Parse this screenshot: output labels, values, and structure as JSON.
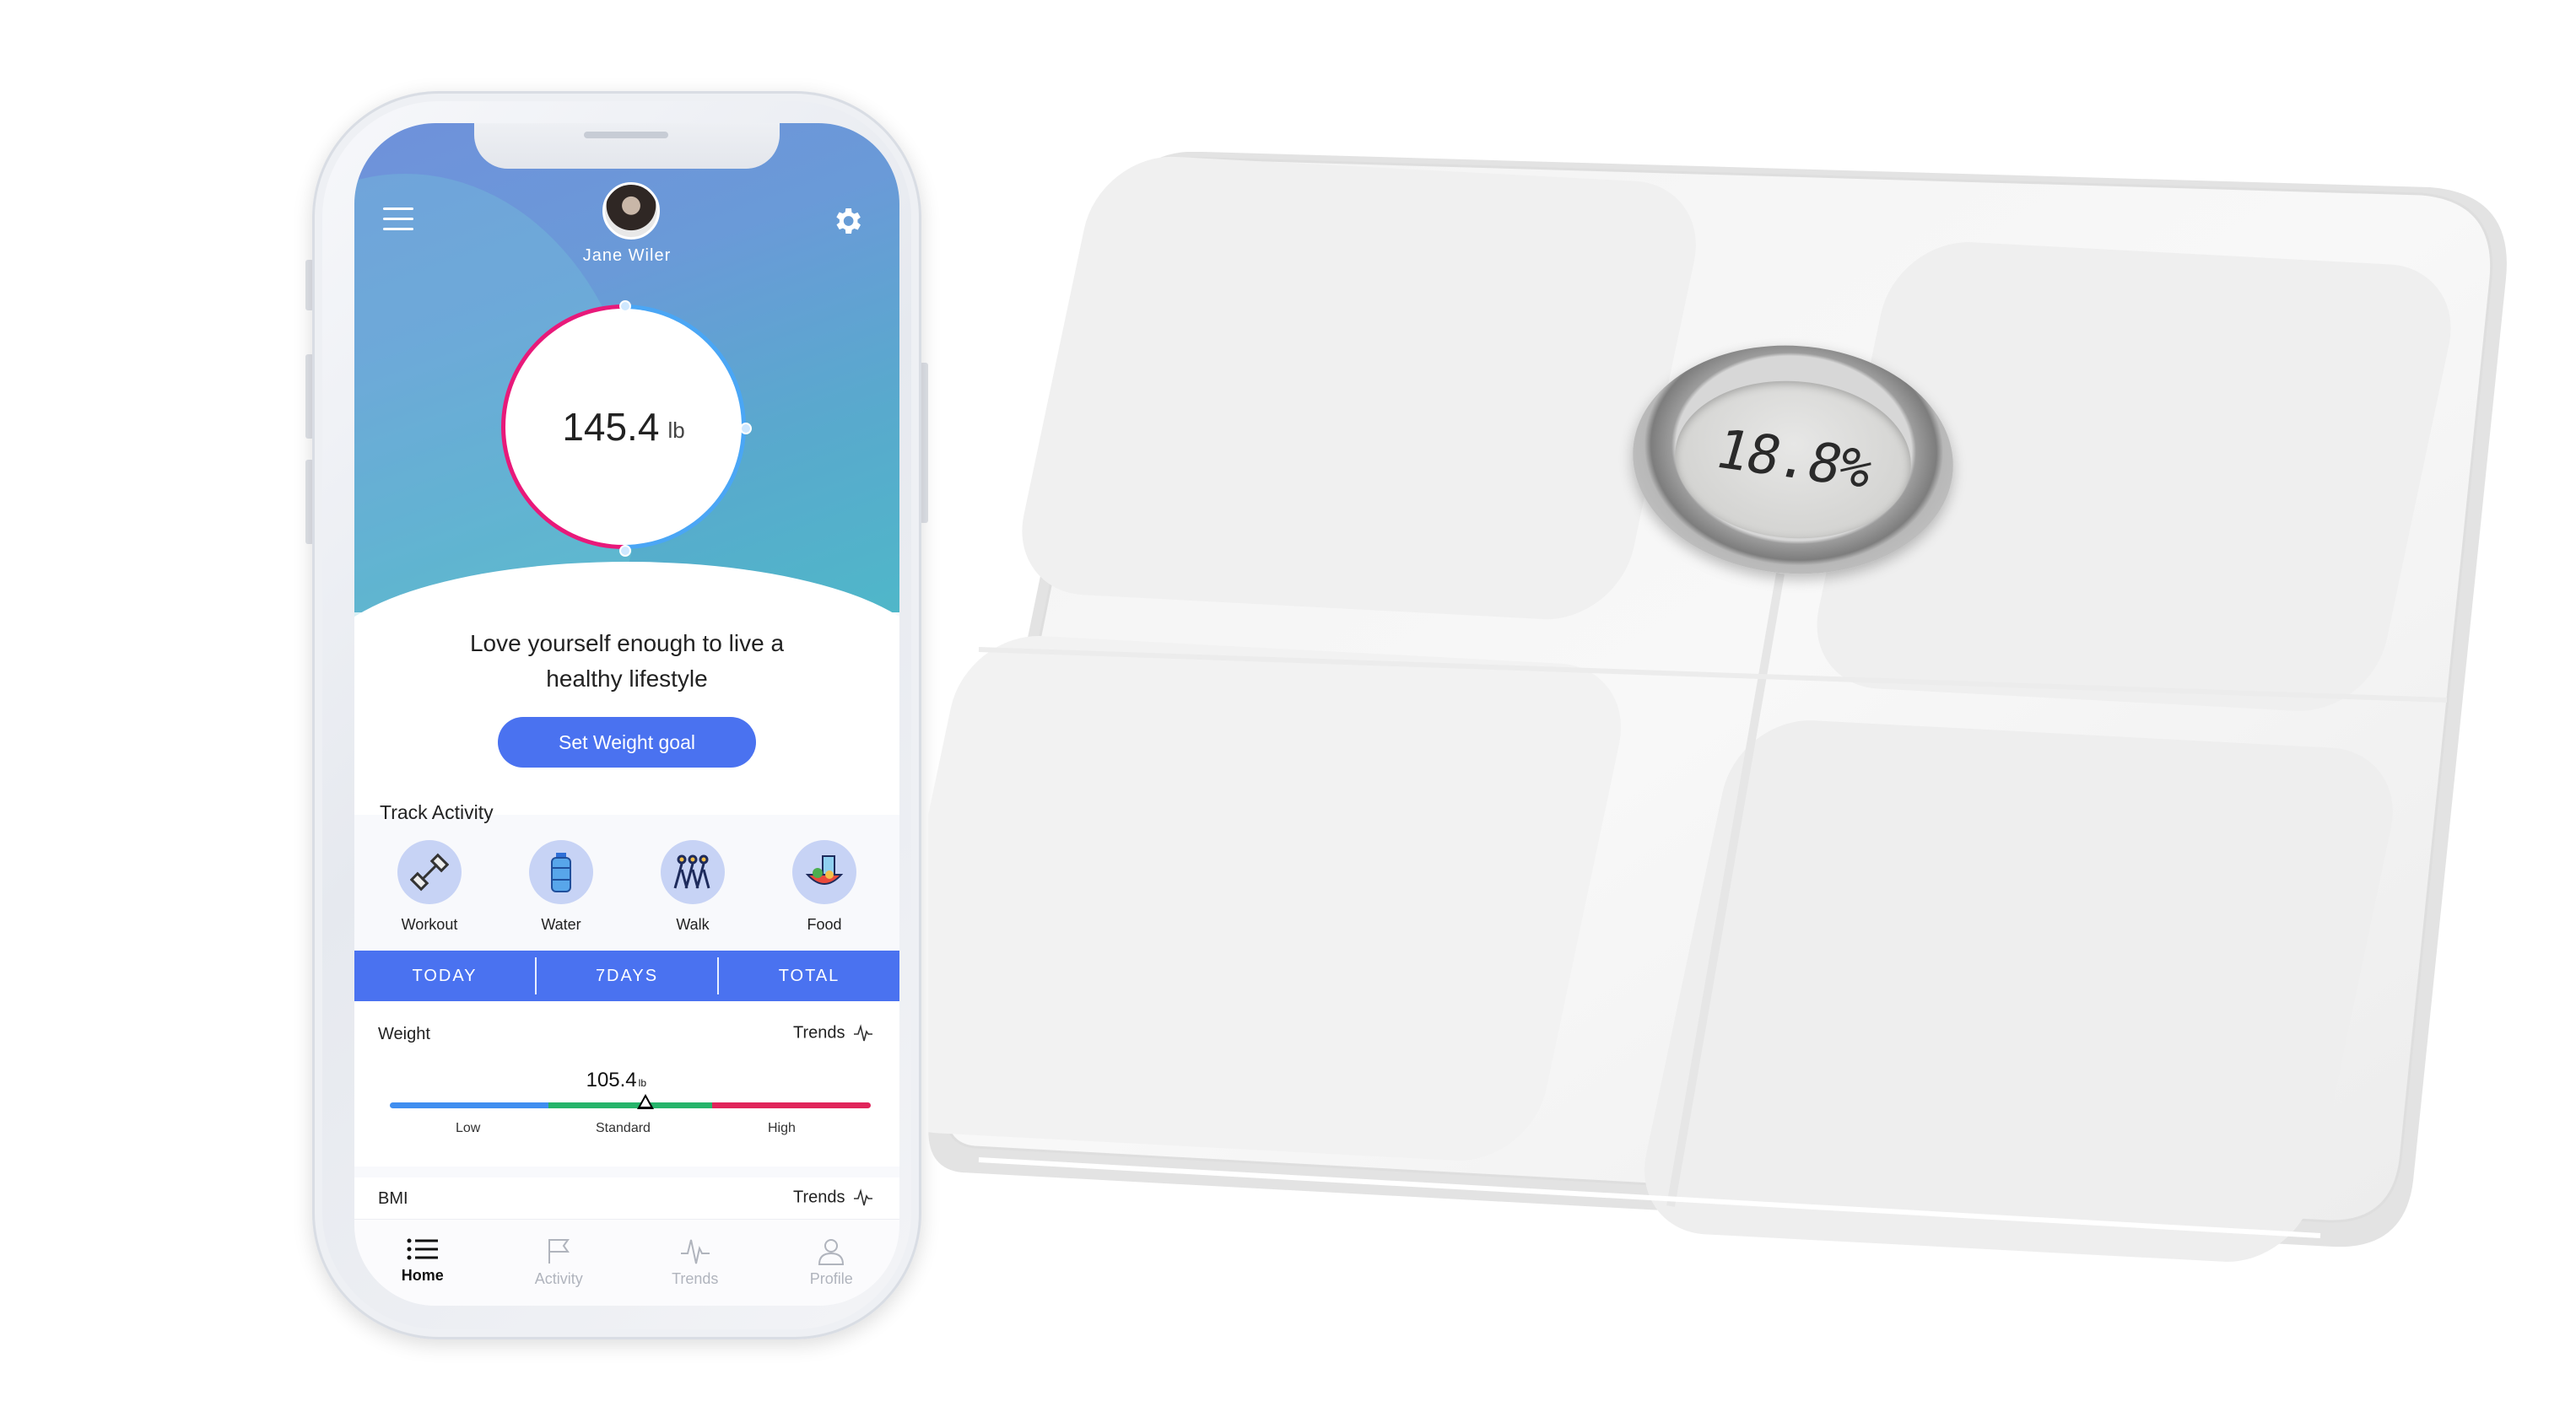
{
  "profile": {
    "name": "Jane Wiler"
  },
  "current_weight": {
    "value": "145.4",
    "unit": "lb"
  },
  "tagline": "Love yourself enough to live a healthy lifestyle",
  "goal_button": "Set Weight goal",
  "track_activity": {
    "title": "Track Activity",
    "items": [
      {
        "label": "Workout",
        "icon": "dumbbell-icon"
      },
      {
        "label": "Water",
        "icon": "water-bottle-icon"
      },
      {
        "label": "Walk",
        "icon": "walk-icon"
      },
      {
        "label": "Food",
        "icon": "food-icon"
      }
    ]
  },
  "range_tabs": [
    "TODAY",
    "7DAYS",
    "TOTAL"
  ],
  "weight_card": {
    "title": "Weight",
    "trends": "Trends",
    "value": "105.4",
    "unit": "lb",
    "labels": [
      "Low",
      "Standard",
      "High"
    ]
  },
  "bmi_card": {
    "title": "BMI",
    "trends": "Trends"
  },
  "nav": [
    {
      "label": "Home",
      "icon": "list-icon",
      "active": true
    },
    {
      "label": "Activity",
      "icon": "flag-icon",
      "active": false
    },
    {
      "label": "Trends",
      "icon": "pulse-icon",
      "active": false
    },
    {
      "label": "Profile",
      "icon": "person-icon",
      "active": false
    }
  ],
  "scale_display": {
    "reading": "18.8%"
  },
  "colors": {
    "accent": "#4a72f0",
    "ring_blue": "#4aa6f5",
    "ring_pink": "#e8197a",
    "low": "#3f8ef0",
    "standard": "#25b46a",
    "high": "#e0245a"
  }
}
